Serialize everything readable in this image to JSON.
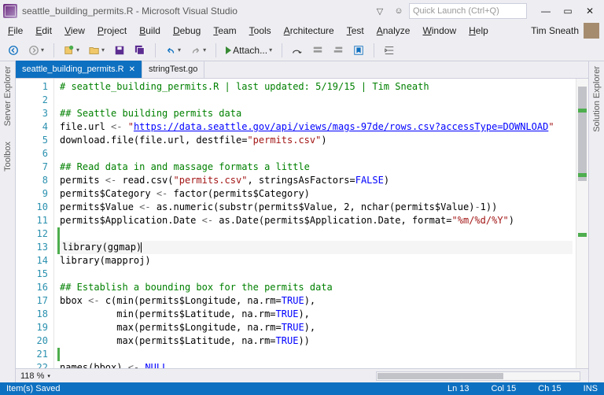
{
  "title": "seattle_building_permits.R - Microsoft Visual Studio",
  "quicklaunch_placeholder": "Quick Launch (Ctrl+Q)",
  "menu": [
    "File",
    "Edit",
    "View",
    "Project",
    "Build",
    "Debug",
    "Team",
    "Tools",
    "Architecture",
    "Test",
    "Analyze",
    "Window",
    "Help"
  ],
  "user_name": "Tim Sneath",
  "attach_label": "Attach...",
  "left_tabs": [
    "Server Explorer",
    "Toolbox"
  ],
  "right_tabs": [
    "Solution Explorer"
  ],
  "doc_tabs": [
    {
      "label": "seattle_building_permits.R",
      "active": true
    },
    {
      "label": "stringTest.go",
      "active": false
    }
  ],
  "zoom": "118 %",
  "status": {
    "saved": "Item(s) Saved",
    "ln": "Ln 13",
    "col": "Col 15",
    "ch": "Ch 15",
    "ins": "INS"
  },
  "code": {
    "lines": [
      {
        "n": 1,
        "seg": [
          [
            "cmt",
            "# seattle_building_permits.R | last updated: 5/19/15 | Tim Sneath"
          ]
        ]
      },
      {
        "n": 2,
        "seg": []
      },
      {
        "n": 3,
        "seg": [
          [
            "cmt",
            "## Seattle building permits data"
          ]
        ]
      },
      {
        "n": 4,
        "seg": [
          [
            "",
            "file.url"
          ],
          [
            "op",
            " <- "
          ],
          [
            "str",
            "\""
          ],
          [
            "url",
            "https://data.seattle.gov/api/views/mags-97de/rows.csv?accessType=DOWNLOAD"
          ],
          [
            "str",
            "\""
          ]
        ]
      },
      {
        "n": 5,
        "seg": [
          [
            "",
            "download.file(file.url, destfile="
          ],
          [
            "str",
            "\"permits.csv\""
          ],
          [
            "",
            ")"
          ]
        ]
      },
      {
        "n": 6,
        "seg": []
      },
      {
        "n": 7,
        "seg": [
          [
            "cmt",
            "## Read data in and massage formats a little"
          ]
        ]
      },
      {
        "n": 8,
        "seg": [
          [
            "",
            "permits"
          ],
          [
            "op",
            " <- "
          ],
          [
            "",
            "read.csv("
          ],
          [
            "str",
            "\"permits.csv\""
          ],
          [
            "",
            ", stringsAsFactors="
          ],
          [
            "kw",
            "FALSE"
          ],
          [
            "",
            ")"
          ]
        ]
      },
      {
        "n": 9,
        "seg": [
          [
            "",
            "permits$Category"
          ],
          [
            "op",
            " <- "
          ],
          [
            "",
            "factor(permits$Category)"
          ]
        ]
      },
      {
        "n": 10,
        "seg": [
          [
            "",
            "permits$Value"
          ],
          [
            "op",
            " <- "
          ],
          [
            "",
            "as.numeric(substr(permits$Value, "
          ],
          [
            "num",
            "2"
          ],
          [
            "",
            ", nchar(permits$Value)"
          ],
          [
            "op",
            "-"
          ],
          [
            "num",
            "1"
          ],
          [
            "",
            "))"
          ]
        ]
      },
      {
        "n": 11,
        "seg": [
          [
            "",
            "permits$Application.Date"
          ],
          [
            "op",
            " <- "
          ],
          [
            "",
            "as.Date(permits$Application.Date, format="
          ],
          [
            "str",
            "\"%m/%d/%Y\""
          ],
          [
            "",
            ")"
          ]
        ]
      },
      {
        "n": 12,
        "seg": [],
        "mark": true
      },
      {
        "n": 13,
        "seg": [
          [
            "",
            "library(ggmap)"
          ]
        ],
        "current": true,
        "cursor": true,
        "mark": true
      },
      {
        "n": 14,
        "seg": [
          [
            "",
            "library(mapproj)"
          ]
        ]
      },
      {
        "n": 15,
        "seg": []
      },
      {
        "n": 16,
        "seg": [
          [
            "cmt",
            "## Establish a bounding box for the permits data"
          ]
        ]
      },
      {
        "n": 17,
        "seg": [
          [
            "",
            "bbox"
          ],
          [
            "op",
            " <- "
          ],
          [
            "",
            "c(min(permits$Longitude, na.rm="
          ],
          [
            "kw",
            "TRUE"
          ],
          [
            "",
            "),"
          ]
        ]
      },
      {
        "n": 18,
        "seg": [
          [
            "",
            "          min(permits$Latitude, na.rm="
          ],
          [
            "kw",
            "TRUE"
          ],
          [
            "",
            "),"
          ]
        ]
      },
      {
        "n": 19,
        "seg": [
          [
            "",
            "          max(permits$Longitude, na.rm="
          ],
          [
            "kw",
            "TRUE"
          ],
          [
            "",
            "),"
          ]
        ]
      },
      {
        "n": 20,
        "seg": [
          [
            "",
            "          max(permits$Latitude, na.rm="
          ],
          [
            "kw",
            "TRUE"
          ],
          [
            "",
            "))"
          ]
        ]
      },
      {
        "n": 21,
        "seg": [],
        "mark": true
      },
      {
        "n": 22,
        "seg": [
          [
            "",
            "names(bbox)"
          ],
          [
            "op",
            " <- "
          ],
          [
            "kw",
            "NULL"
          ]
        ]
      }
    ]
  }
}
